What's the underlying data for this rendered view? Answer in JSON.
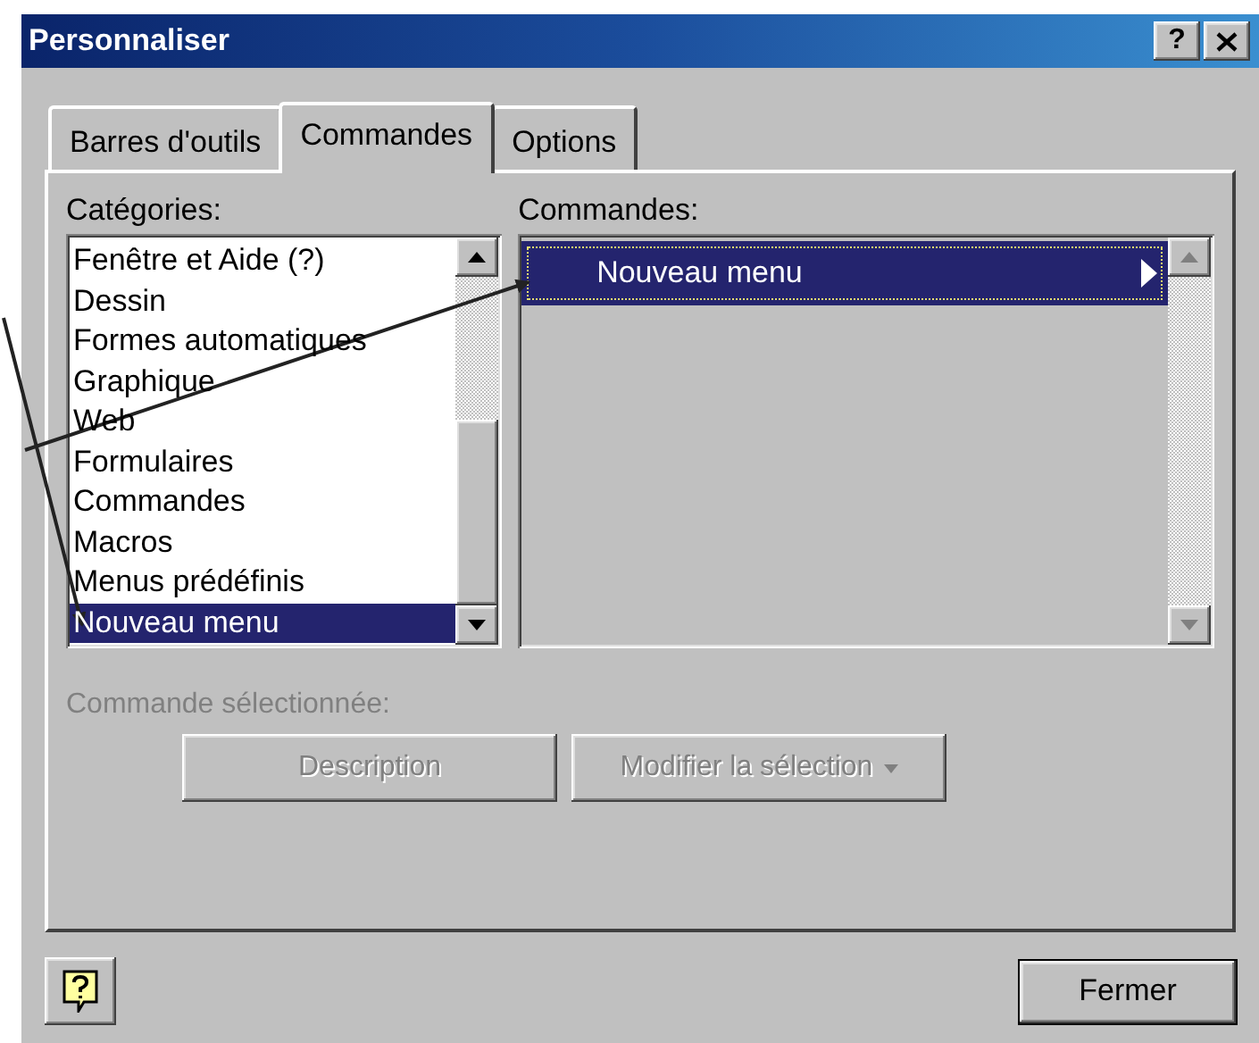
{
  "window": {
    "title": "Personnaliser",
    "title_buttons": [
      {
        "kind": "help",
        "label": "?"
      },
      {
        "kind": "close"
      }
    ]
  },
  "tabs": [
    {
      "label": "Barres d'outils",
      "selected": false
    },
    {
      "label": "Commandes",
      "selected": true
    },
    {
      "label": "Options",
      "selected": false
    }
  ],
  "categories": {
    "label": "Catégories:",
    "items": [
      {
        "label": "Fenêtre et Aide (?)",
        "selected": false
      },
      {
        "label": "Dessin",
        "selected": false
      },
      {
        "label": "Formes automatiques",
        "selected": false
      },
      {
        "label": "Graphique",
        "selected": false
      },
      {
        "label": "Web",
        "selected": false
      },
      {
        "label": "Formulaires",
        "selected": false
      },
      {
        "label": "Commandes",
        "selected": false
      },
      {
        "label": "Macros",
        "selected": false
      },
      {
        "label": "Menus prédéfinis",
        "selected": false
      },
      {
        "label": "Nouveau menu",
        "selected": true
      }
    ]
  },
  "commands": {
    "label": "Commandes:",
    "items": [
      {
        "label": "Nouveau menu",
        "selected": true,
        "has_submenu": true
      }
    ]
  },
  "selected_command": {
    "label": "Commande sélectionnée:",
    "disabled": true
  },
  "command_buttons": [
    {
      "label": "Description",
      "kind": "button",
      "disabled": true
    },
    {
      "label": "Modifier la sélection",
      "kind": "dropdown",
      "disabled": true
    }
  ],
  "footer": {
    "help_button": {
      "kind": "help"
    },
    "close_button": {
      "label": "Fermer"
    }
  }
}
